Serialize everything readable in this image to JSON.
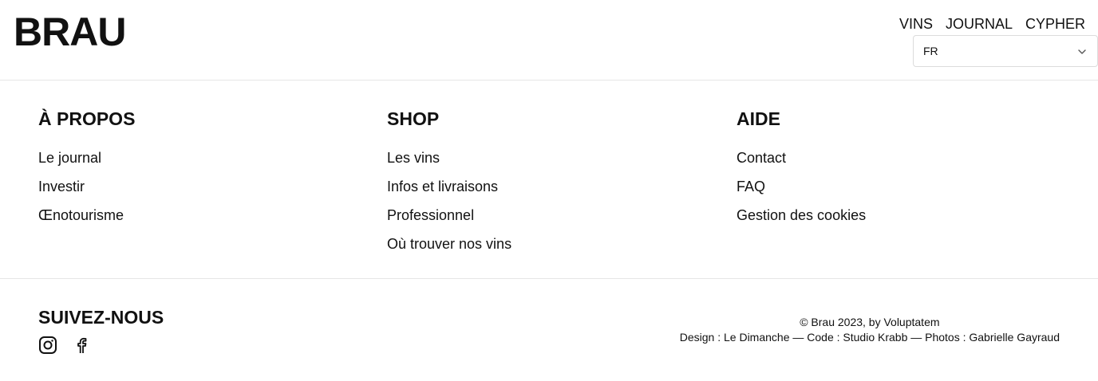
{
  "header": {
    "logo": "BRAU",
    "nav": [
      "VINS",
      "JOURNAL",
      "CYPHER"
    ],
    "language": "FR"
  },
  "columns": [
    {
      "title": "À PROPOS",
      "links": [
        "Le journal",
        "Investir",
        "Œnotourisme"
      ]
    },
    {
      "title": "SHOP",
      "links": [
        "Les vins",
        "Infos et livraisons",
        "Professionnel",
        "Où trouver nos vins"
      ]
    },
    {
      "title": "AIDE",
      "links": [
        "Contact",
        "FAQ",
        "Gestion des cookies"
      ]
    }
  ],
  "follow": {
    "title": "SUIVEZ-NOUS",
    "icons": [
      "instagram-icon",
      "facebook-icon"
    ]
  },
  "credits": {
    "line1": "© Brau 2023, by Voluptatem",
    "line2": "Design : Le Dimanche — Code : Studio Krabb — Photos : Gabrielle Gayraud"
  },
  "colors": {
    "text": "#111111",
    "border": "#e6e6e6",
    "background": "#ffffff"
  }
}
